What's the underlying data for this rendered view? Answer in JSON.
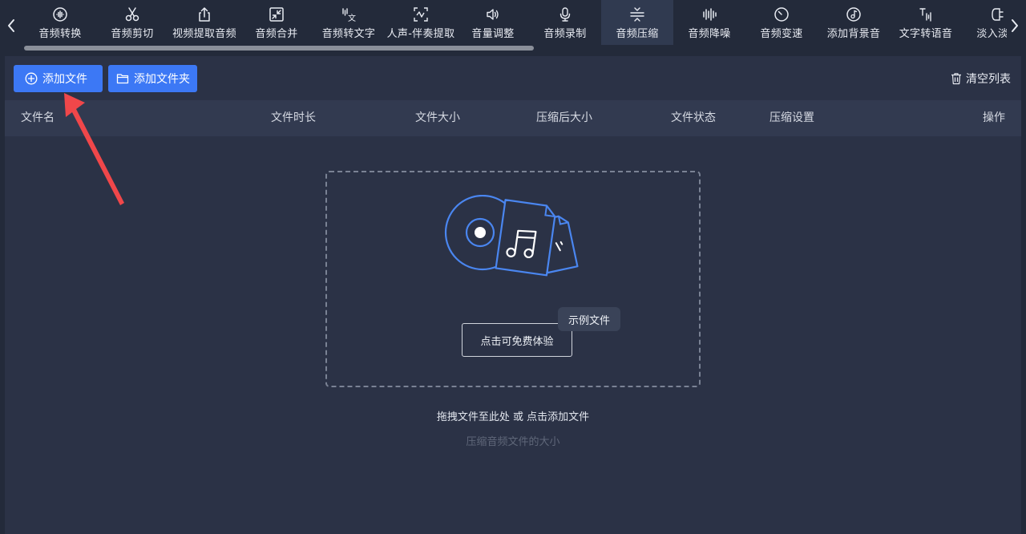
{
  "toolbar": {
    "tools": [
      {
        "label": "音频转换",
        "icon": "audio-convert-icon"
      },
      {
        "label": "音频剪切",
        "icon": "scissors-icon"
      },
      {
        "label": "视频提取音频",
        "icon": "export-icon"
      },
      {
        "label": "音频合并",
        "icon": "merge-icon"
      },
      {
        "label": "音频转文字",
        "icon": "speech-to-text-icon"
      },
      {
        "label": "人声-伴奏提取",
        "icon": "vocal-separate-icon"
      },
      {
        "label": "音量调整",
        "icon": "volume-icon"
      },
      {
        "label": "音频录制",
        "icon": "microphone-icon"
      },
      {
        "label": "音频压缩",
        "icon": "compress-icon"
      },
      {
        "label": "音频降噪",
        "icon": "waveform-icon"
      },
      {
        "label": "音频变速",
        "icon": "speedometer-icon"
      },
      {
        "label": "添加背景音",
        "icon": "music-note-icon"
      },
      {
        "label": "文字转语音",
        "icon": "text-to-speech-icon"
      },
      {
        "label": "淡入淡出",
        "icon": "fade-icon"
      }
    ],
    "active_index": 8
  },
  "actions": {
    "add_file": "添加文件",
    "add_folder": "添加文件夹",
    "clear_list": "清空列表"
  },
  "table": {
    "columns": [
      "文件名",
      "文件时长",
      "文件大小",
      "压缩后大小",
      "文件状态",
      "压缩设置",
      "操作"
    ]
  },
  "dropzone": {
    "trial_button": "点击可免费体验",
    "sample_badge": "示例文件",
    "hint": "拖拽文件至此处 或 点击添加文件",
    "subhint": "压缩音频文件的大小"
  },
  "colors": {
    "accent": "#3c78f5",
    "annotation_arrow": "#f0474a"
  }
}
